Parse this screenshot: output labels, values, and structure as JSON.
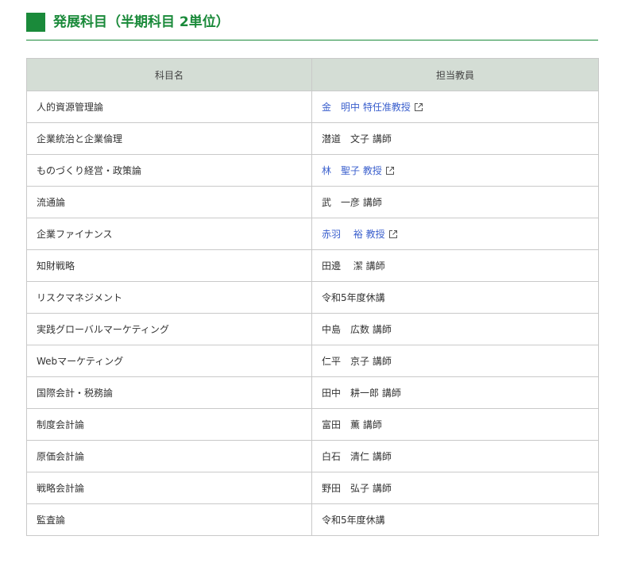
{
  "section": {
    "title": "発展科目（半期科目 2単位）",
    "accent_color": "#1a8a3a"
  },
  "table": {
    "headers": [
      "科目名",
      "担当教員"
    ],
    "header_bg": "#d4ddd5",
    "link_color": "#3a5fcd",
    "rows": [
      {
        "course": "人的資源管理論",
        "teacher": "金　明中 特任准教授",
        "link": true
      },
      {
        "course": "企業統治と企業倫理",
        "teacher": "潜道　文子 講師",
        "link": false
      },
      {
        "course": "ものづくり経営・政策論",
        "teacher": "林　聖子 教授",
        "link": true
      },
      {
        "course": "流通論",
        "teacher": "武　一彦 講師",
        "link": false
      },
      {
        "course": "企業ファイナンス",
        "teacher": "赤羽　 裕 教授",
        "link": true
      },
      {
        "course": "知財戦略",
        "teacher": "田邊　 潔 講師",
        "link": false
      },
      {
        "course": "リスクマネジメント",
        "teacher": "令和5年度休講",
        "link": false
      },
      {
        "course": "実践グローバルマーケティング",
        "teacher": "中島　広数 講師",
        "link": false
      },
      {
        "course": "Webマーケティング",
        "teacher": "仁平　京子 講師",
        "link": false
      },
      {
        "course": "国際会計・税務論",
        "teacher": "田中　耕一郎 講師",
        "link": false
      },
      {
        "course": "制度会計論",
        "teacher": "富田　薫 講師",
        "link": false
      },
      {
        "course": "原価会計論",
        "teacher": "白石　清仁 講師",
        "link": false
      },
      {
        "course": "戦略会計論",
        "teacher": "野田　弘子 講師",
        "link": false
      },
      {
        "course": "監査論",
        "teacher": "令和5年度休講",
        "link": false
      }
    ]
  }
}
